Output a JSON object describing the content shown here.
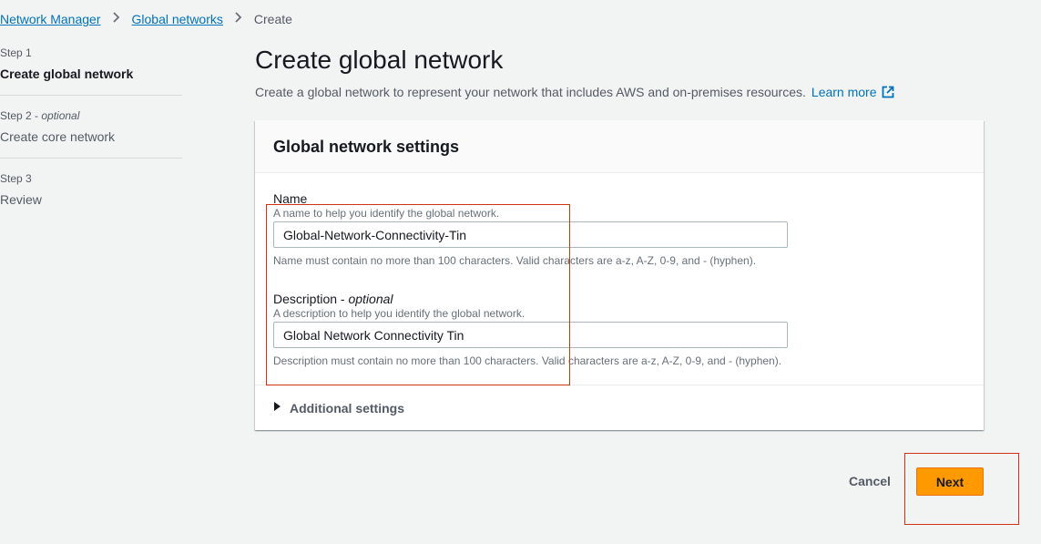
{
  "breadcrumb": {
    "items": [
      "Network Manager",
      "Global networks"
    ],
    "current": "Create"
  },
  "steps": [
    {
      "num": "Step 1",
      "optional": "",
      "label": "Create global network"
    },
    {
      "num": "Step 2 - ",
      "optional": "optional",
      "label": "Create core network"
    },
    {
      "num": "Step 3",
      "optional": "",
      "label": "Review"
    }
  ],
  "page": {
    "title": "Create global network",
    "description": "Create a global network to represent your network that includes AWS and on-premises resources.",
    "learn_more": "Learn more"
  },
  "panel": {
    "title": "Global network settings",
    "name": {
      "label": "Name",
      "description": "A name to help you identify the global network.",
      "value": "Global-Network-Connectivity-Tin",
      "constraint": "Name must contain no more than 100 characters. Valid characters are a-z, A-Z, 0-9, and - (hyphen)."
    },
    "desc_field": {
      "label": "Description - ",
      "label_optional": "optional",
      "description": "A description to help you identify the global network.",
      "value": "Global Network Connectivity Tin",
      "constraint": "Description must contain no more than 100 characters. Valid characters are a-z, A-Z, 0-9, and - (hyphen)."
    },
    "additional": "Additional settings"
  },
  "actions": {
    "cancel": "Cancel",
    "next": "Next"
  },
  "colors": {
    "link": "#0073bb",
    "primary_button": "#ff9900",
    "highlight": "#d13212"
  },
  "icons": {
    "breadcrumb_separator": "chevron-right-icon",
    "learn_more": "external-link-icon",
    "additional_settings": "caret-right-icon"
  }
}
